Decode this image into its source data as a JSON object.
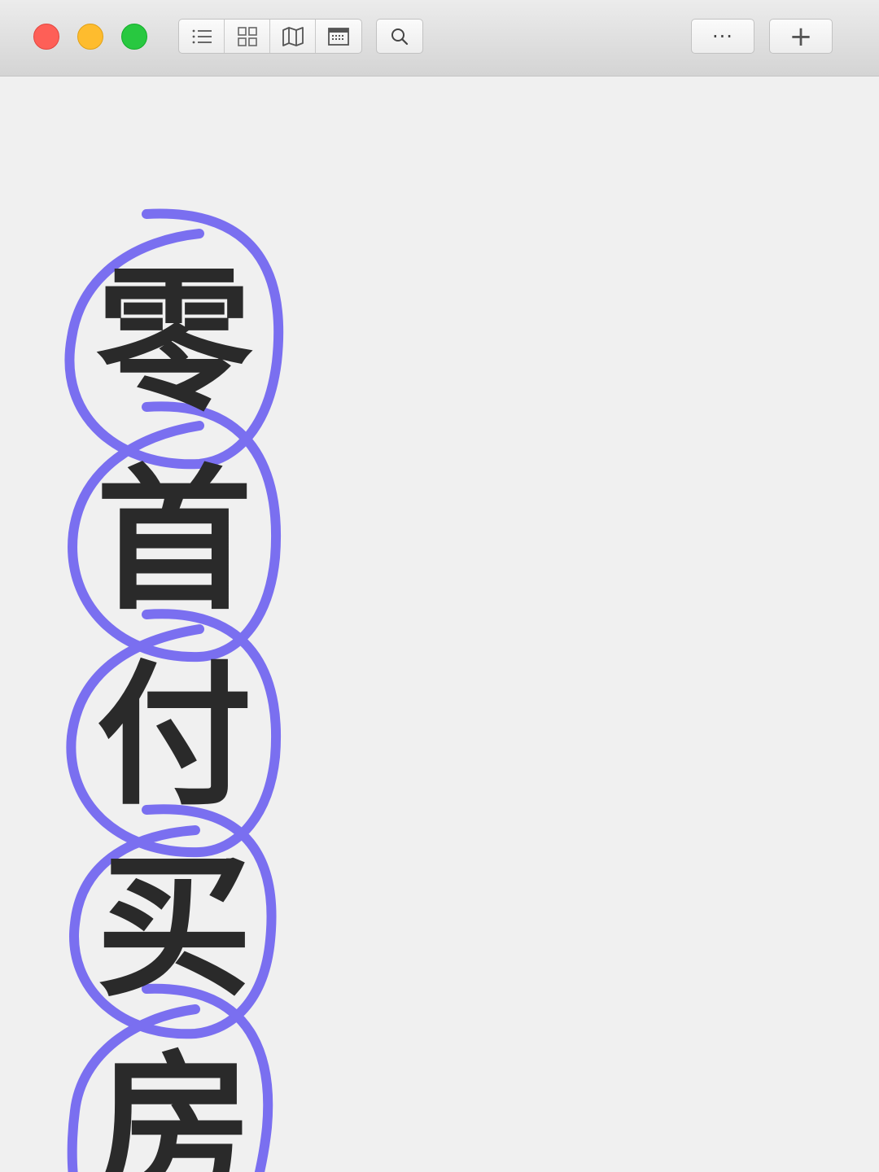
{
  "toolbar": {
    "view_buttons": [
      {
        "name": "list-view",
        "icon": "list-icon"
      },
      {
        "name": "grid-view",
        "icon": "grid-icon"
      },
      {
        "name": "map-view",
        "icon": "map-icon"
      },
      {
        "name": "calendar-view",
        "icon": "calendar-icon"
      }
    ],
    "search_icon": "search-icon",
    "more_label": "···",
    "add_label": "+"
  },
  "traffic_lights": {
    "close_color": "#fe5f57",
    "minimize_color": "#febc2e",
    "maximize_color": "#28c840"
  },
  "main": {
    "characters": [
      "零",
      "首",
      "付",
      "买",
      "房"
    ],
    "circle_color": "#7a6ff0"
  }
}
